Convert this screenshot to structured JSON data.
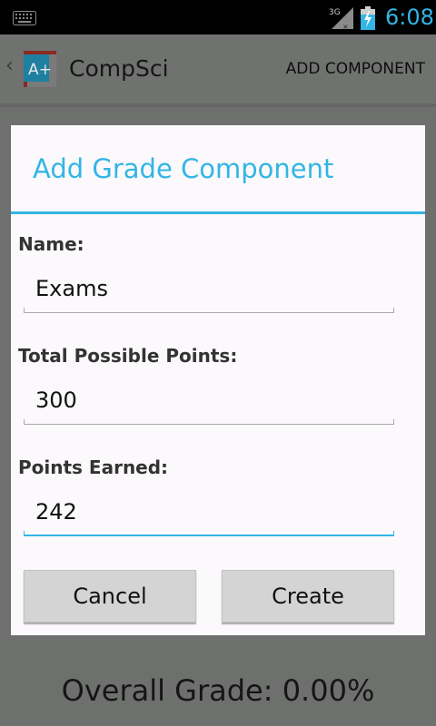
{
  "status_bar": {
    "keyboard_icon": "keyboard-icon",
    "network": "3G",
    "signal_icon": "signal-icon",
    "battery_icon": "battery-charging-icon",
    "time": "6:08",
    "accent_color": "#33b5e5"
  },
  "action_bar": {
    "app_icon_text": "A+",
    "title": "CompSci",
    "action_label": "ADD COMPONENT"
  },
  "background": {
    "overall_grade": "Overall Grade: 0.00%"
  },
  "dialog": {
    "title": "Add Grade Component",
    "fields": [
      {
        "label": "Name:",
        "value": "Exams"
      },
      {
        "label": "Total Possible Points:",
        "value": "300"
      },
      {
        "label": "Points Earned:",
        "value": "242"
      }
    ],
    "cancel_label": "Cancel",
    "create_label": "Create"
  }
}
